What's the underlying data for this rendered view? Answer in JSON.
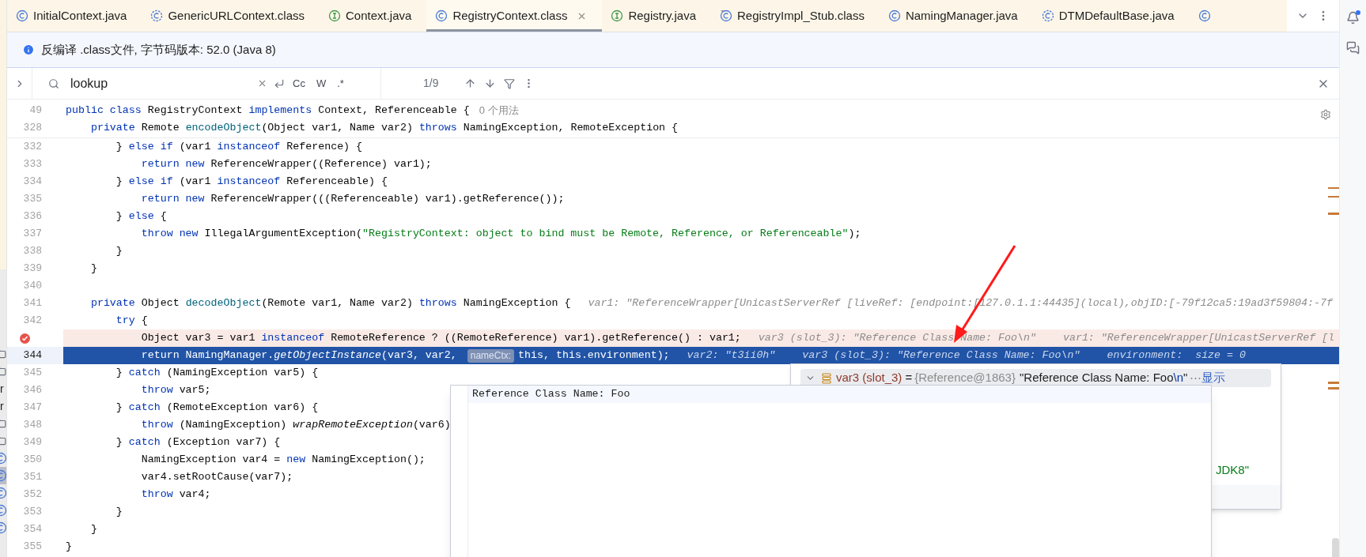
{
  "tabs": [
    {
      "label": "InitialContext.java",
      "kind": "class",
      "selected": false
    },
    {
      "label": "GenericURLContext.class",
      "kind": "library_class",
      "selected": false
    },
    {
      "label": "Context.java",
      "kind": "interface",
      "selected": false
    },
    {
      "label": "RegistryContext.class",
      "kind": "class",
      "selected": true
    },
    {
      "label": "Registry.java",
      "kind": "interface",
      "selected": false
    },
    {
      "label": "RegistryImpl_Stub.class",
      "kind": "stub_class",
      "selected": false
    },
    {
      "label": "NamingManager.java",
      "kind": "class",
      "selected": false
    },
    {
      "label": "DTMDefaultBase.java",
      "kind": "library_class",
      "selected": false
    }
  ],
  "info_bar": {
    "text": "反编译 .class文件, 字节码版本: 52.0 (Java 8)"
  },
  "search": {
    "value": "lookup",
    "options": [
      {
        "label": "Cc",
        "selected": false
      },
      {
        "label": "W",
        "selected": false
      },
      {
        "label": ".*",
        "selected": false
      }
    ],
    "match_count": "1/9"
  },
  "project_panel": {
    "items": [
      {
        "kind": "folder",
        "selected": false
      },
      {
        "kind": "folder",
        "selected": false
      },
      {
        "kind": "text",
        "text": "r",
        "selected": false
      },
      {
        "kind": "text",
        "text": "r",
        "selected": false
      },
      {
        "kind": "folder",
        "selected": false
      },
      {
        "kind": "folder",
        "selected": false
      },
      {
        "kind": "class",
        "selected": false
      },
      {
        "kind": "class",
        "selected": true
      },
      {
        "kind": "class",
        "selected": false
      },
      {
        "kind": "class",
        "selected": false
      },
      {
        "kind": "class",
        "selected": false
      }
    ]
  },
  "editor": {
    "sticky_lines": [
      {
        "number": "49",
        "tokens": [
          {
            "kind": "keyword",
            "text": "public class"
          },
          {
            "text": " RegistryContext "
          },
          {
            "kind": "keyword",
            "text": "implements"
          },
          {
            "text": " Context, Referenceable {"
          }
        ],
        "usages": "0 个用法"
      },
      {
        "number": "328",
        "tokens": [
          {
            "kind": "keyword",
            "text": "    private"
          },
          {
            "text": " Remote "
          },
          {
            "kind": "declaration",
            "text": "encodeObject"
          },
          {
            "text": "(Object var1, Name var2) "
          },
          {
            "kind": "keyword",
            "text": "throws"
          },
          {
            "text": " NamingException, RemoteException {"
          }
        ]
      }
    ],
    "lines": [
      {
        "number": "332",
        "kind": "code",
        "tokens": [
          {
            "text": "        } "
          },
          {
            "kind": "keyword",
            "text": "else if"
          },
          {
            "text": " (var1 "
          },
          {
            "kind": "keyword",
            "text": "instanceof"
          },
          {
            "text": " Reference) {"
          }
        ]
      },
      {
        "number": "333",
        "kind": "code",
        "tokens": [
          {
            "kind": "keyword",
            "text": "            return new"
          },
          {
            "text": " ReferenceWrapper((Reference) var1);"
          }
        ]
      },
      {
        "number": "334",
        "kind": "code",
        "tokens": [
          {
            "text": "        } "
          },
          {
            "kind": "keyword",
            "text": "else if"
          },
          {
            "text": " (var1 "
          },
          {
            "kind": "keyword",
            "text": "instanceof"
          },
          {
            "text": " Referenceable) {"
          }
        ]
      },
      {
        "number": "335",
        "kind": "code",
        "tokens": [
          {
            "kind": "keyword",
            "text": "            return new"
          },
          {
            "text": " ReferenceWrapper(((Referenceable) var1).getReference());"
          }
        ]
      },
      {
        "number": "336",
        "kind": "code",
        "tokens": [
          {
            "text": "        } "
          },
          {
            "kind": "keyword",
            "text": "else"
          },
          {
            "text": " {"
          }
        ]
      },
      {
        "number": "337",
        "kind": "code",
        "tokens": [
          {
            "kind": "keyword",
            "text": "            throw new"
          },
          {
            "text": " IllegalArgumentException("
          },
          {
            "kind": "string",
            "text": "\"RegistryContext: object to bind must be Remote, Reference, or Referenceable\""
          },
          {
            "text": ");"
          }
        ]
      },
      {
        "number": "338",
        "kind": "code",
        "tokens": [
          {
            "text": "        }"
          }
        ]
      },
      {
        "number": "339",
        "kind": "code",
        "tokens": [
          {
            "text": "    }"
          }
        ]
      },
      {
        "number": "340",
        "kind": "code"
      },
      {
        "number": "341",
        "kind": "code",
        "tokens": [
          {
            "kind": "keyword",
            "text": "    private"
          },
          {
            "text": " Object "
          },
          {
            "kind": "declaration",
            "text": "decodeObject"
          },
          {
            "text": "(Remote var1, Name var2) "
          },
          {
            "kind": "keyword",
            "text": "throws"
          },
          {
            "text": " NamingException {"
          }
        ],
        "hints": [
          "var1: \"ReferenceWrapper[UnicastServerRef [liveRef: [endpoint:[127.0.1.1:44435](local),objID:[-79f12ca5:19ad3f59804:-7f"
        ]
      },
      {
        "number": "342",
        "kind": "code",
        "tokens": [
          {
            "kind": "keyword",
            "text": "        try"
          },
          {
            "text": " {"
          }
        ]
      },
      {
        "kind": "breakpoint",
        "tokens": [
          {
            "text": "            Object var3 = var1 "
          },
          {
            "kind": "keyword",
            "text": "instanceof"
          },
          {
            "text": " RemoteReference ? ((RemoteReference) var1).getReference() : var1;"
          }
        ],
        "hints": [
          "var3 (slot_3): \"Reference Class Name: Foo\\n\"",
          "var1: \"ReferenceWrapper[UnicastServerRef [l"
        ]
      },
      {
        "number": "344",
        "kind": "current",
        "tokens": [
          {
            "kind": "keyword",
            "text": "            return"
          },
          {
            "text": " NamingManager."
          },
          {
            "kind": "static_call",
            "text": "getObjectInstance"
          },
          {
            "text": "(var3, var2, "
          },
          {
            "kind": "parameter_hint",
            "text": "nameCtx:"
          },
          {
            "text": "this, this.environment);"
          }
        ],
        "hints": [
          "var2: \"t3ii0h\"",
          "var3 (slot_3): \"Reference Class Name: Foo\\n\"",
          "environment:  size = 0"
        ]
      },
      {
        "number": "345",
        "kind": "code",
        "tokens": [
          {
            "text": "        } "
          },
          {
            "kind": "keyword",
            "text": "catch"
          },
          {
            "text": " (NamingException var5) {"
          }
        ]
      },
      {
        "number": "346",
        "kind": "code",
        "tokens": [
          {
            "kind": "keyword",
            "text": "            throw"
          },
          {
            "text": " var5;"
          }
        ]
      },
      {
        "number": "347",
        "kind": "code",
        "tokens": [
          {
            "text": "        } "
          },
          {
            "kind": "keyword",
            "text": "catch"
          },
          {
            "text": " (RemoteException var6) {"
          }
        ]
      },
      {
        "number": "348",
        "kind": "code",
        "tokens": [
          {
            "kind": "keyword",
            "text": "            throw"
          },
          {
            "text": " (NamingException) "
          },
          {
            "kind": "static_call",
            "text": "wrapRemoteException"
          },
          {
            "text": "(var6)"
          }
        ]
      },
      {
        "number": "349",
        "kind": "code",
        "tokens": [
          {
            "text": "        } "
          },
          {
            "kind": "keyword",
            "text": "catch"
          },
          {
            "text": " (Exception var7) {"
          }
        ]
      },
      {
        "number": "350",
        "kind": "code",
        "tokens": [
          {
            "text": "            NamingException var4 = "
          },
          {
            "kind": "keyword",
            "text": "new"
          },
          {
            "text": " NamingException();"
          }
        ]
      },
      {
        "number": "351",
        "kind": "code",
        "tokens": [
          {
            "text": "            var4.setRootCause(var7);"
          }
        ]
      },
      {
        "number": "352",
        "kind": "code",
        "tokens": [
          {
            "kind": "keyword",
            "text": "            throw"
          },
          {
            "text": " var4;"
          }
        ]
      },
      {
        "number": "353",
        "kind": "code",
        "tokens": [
          {
            "text": "        }"
          }
        ]
      },
      {
        "number": "354",
        "kind": "code",
        "tokens": [
          {
            "text": "    }"
          }
        ]
      },
      {
        "number": "355",
        "kind": "code",
        "tokens": [
          {
            "text": "}"
          }
        ]
      }
    ]
  },
  "value_popup": {
    "expanded": true,
    "name": "var3 (slot_3)",
    "equals": "=",
    "type": "{Reference@1863}",
    "value": "\"Reference Class Name: Foo",
    "escape": "\\n",
    "closing": "\"",
    "ellipsis": "⋯",
    "link": "显示",
    "hidden_value": "JDK8\""
  },
  "text_popup": {
    "lines": [
      "Reference Class Name: Foo"
    ]
  }
}
